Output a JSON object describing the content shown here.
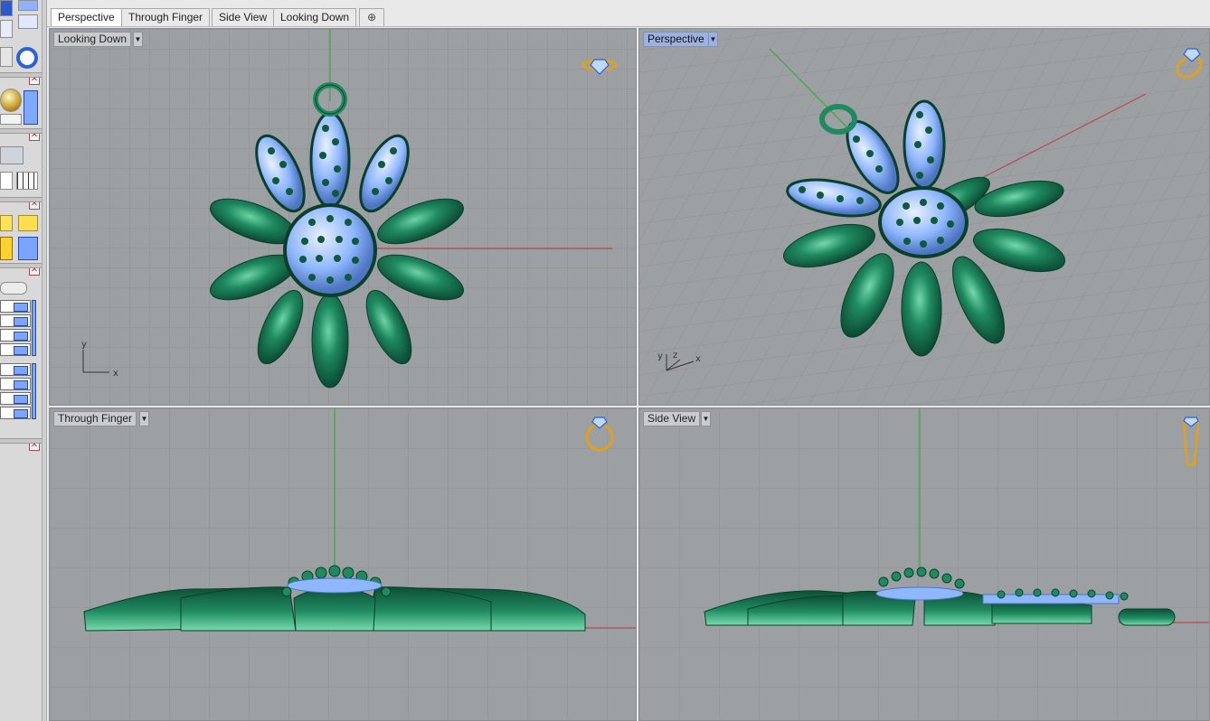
{
  "tabs": [
    {
      "label": "Perspective",
      "active": true
    },
    {
      "label": "Through Finger",
      "active": false
    },
    {
      "label": "Side View",
      "active": false
    },
    {
      "label": "Looking Down",
      "active": false
    }
  ],
  "tab_add_glyph": "⊕",
  "viewports": {
    "looking_down": {
      "title": "Looking Down",
      "axis_x": "x",
      "axis_y": "y"
    },
    "perspective": {
      "title": "Perspective",
      "axis_x": "x",
      "axis_y": "y",
      "axis_z": "z",
      "active": true
    },
    "through_finger": {
      "title": "Through Finger"
    },
    "side_view": {
      "title": "Side View"
    }
  },
  "icons": {
    "view_badges": [
      "diamond-ring-top-icon",
      "diamond-ring-perspective-icon",
      "ring-front-icon",
      "ring-side-icon"
    ],
    "toolbar": [
      "snake-icon",
      "circle-icon",
      "sphere-icon",
      "layer-icon",
      "lock-icon",
      "grid-icon",
      "eye-icon"
    ]
  },
  "colors": {
    "viewport_bg": "#9da0a2",
    "grid": "#8d9093",
    "grid_major": "#7e8184",
    "metal": "#1e7a56",
    "metal_dark": "#0d4f36",
    "metal_light": "#5cc59a",
    "gem": "#8fb7ff",
    "x_axis": "#b54a4a",
    "y_axis": "#42a442",
    "badge": "#e0a020",
    "active_label": "#9db0df"
  }
}
